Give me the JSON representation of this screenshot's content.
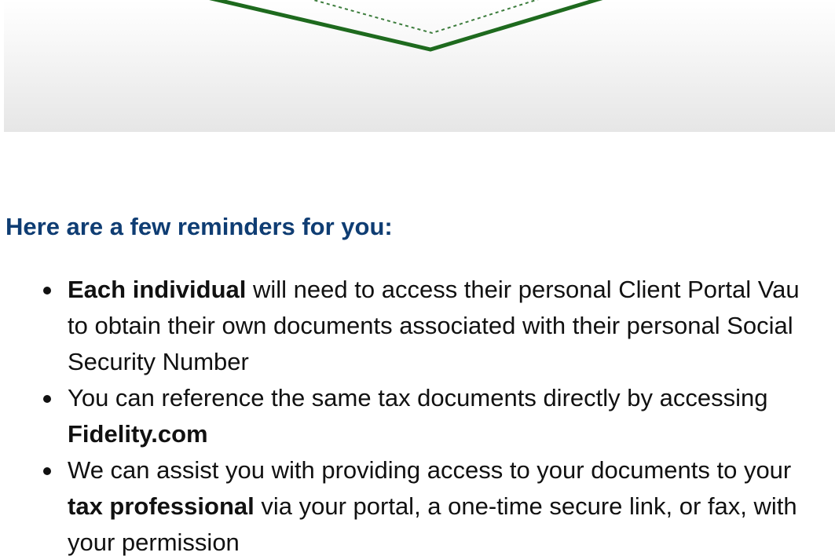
{
  "colors": {
    "heading": "#0f3d73",
    "body_text": "#111111",
    "banner_stroke": "#1e6a1e",
    "banner_bg": "#efefef"
  },
  "heading": "Here are a few reminders for you:",
  "reminders": [
    {
      "lines": [
        {
          "bold": "Each individual",
          "text": " will need to access their personal Client Portal Vau"
        },
        {
          "bold": "",
          "text": "to obtain their own documents associated with their personal Social"
        },
        {
          "bold": "",
          "text": "Security Number"
        }
      ]
    },
    {
      "lines": [
        {
          "bold": "",
          "text": "You can reference the same tax documents directly by accessing"
        },
        {
          "bold": "Fidelity.com",
          "text": ""
        }
      ]
    },
    {
      "lines": [
        {
          "bold": "",
          "text": "We can assist you with providing access to your documents to your"
        },
        {
          "bold": "tax professional",
          "text": " via your portal, a one-time secure link, or fax, with"
        },
        {
          "bold": "",
          "text": "your permission"
        }
      ]
    }
  ]
}
